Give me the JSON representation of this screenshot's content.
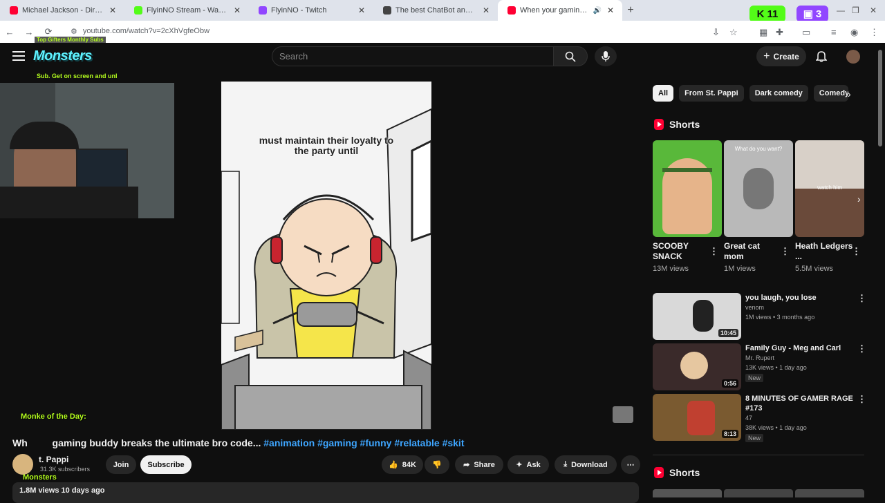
{
  "browser": {
    "tabs": [
      {
        "title": "Michael Jackson - Dirty Diana (",
        "favicon": "youtube-icon",
        "color": "#ff0033"
      },
      {
        "title": "FlyinNO Stream - Watch Live o",
        "favicon": "kick-icon",
        "color": "#53fc18"
      },
      {
        "title": "FlyinNO - Twitch",
        "favicon": "twitch-icon",
        "color": "#9146ff"
      },
      {
        "title": "The best ChatBot and Widgets",
        "favicon": "streamelements-icon",
        "color": "#444444"
      },
      {
        "title": "When your gaming buddy",
        "favicon": "youtube-icon",
        "color": "#ff0033",
        "active": true
      }
    ],
    "kick_count": "11",
    "twitch_count": "3",
    "url": "youtube.com/watch?v=2cXhVgfeObw"
  },
  "overlay": {
    "top_ticker": "Top Gifters Monthly Subs",
    "logo": "Monsters",
    "sub_ticker": "Sub. Get on screen and unl",
    "monke_label": "Monke of the Day:",
    "monsters_tag": "Monsters"
  },
  "yt": {
    "search_placeholder": "Search",
    "create_label": "Create"
  },
  "video": {
    "caption_line1": "must maintain their loyalty to",
    "caption_line2": "the party until",
    "title_prefix": "Wh",
    "title_main": "gaming buddy breaks the ultimate bro code...",
    "hashtags": [
      "#animation",
      "#gaming",
      "#funny",
      "#relatable",
      "#skit"
    ],
    "channel": "t. Pappi",
    "subscribers": "31.3K subscribers",
    "join": "Join",
    "subscribe": "Subscribe",
    "likes": "84K",
    "share": "Share",
    "ask": "Ask",
    "download": "Download",
    "views_date": "1.8M views  10 days ago"
  },
  "sidebar": {
    "chips": [
      "All",
      "From St. Pappi",
      "Dark comedy",
      "Comedy"
    ],
    "shorts_heading": "Shorts",
    "shorts": [
      {
        "title": "SCOOBY SNACK",
        "views": "13M views"
      },
      {
        "title": "Great cat mom",
        "views": "1M views",
        "thumb_text": "What do you want?"
      },
      {
        "title": "Heath Ledgers ...",
        "views": "5.5M views",
        "thumb_text": "watch him"
      }
    ],
    "related": [
      {
        "title": "you laugh, you lose",
        "channel": "venom",
        "meta": "1M views • 3 months ago",
        "duration": "10:45"
      },
      {
        "title": "Family Guy - Meg and Carl",
        "channel": "Mr. Rupert",
        "meta": "13K views • 1 day ago",
        "duration": "0:56",
        "badge": "New"
      },
      {
        "title": "8 MINUTES OF GAMER RAGE #173",
        "channel": "47",
        "meta": "38K views • 1 day ago",
        "duration": "8:13",
        "badge": "New"
      }
    ],
    "shorts_heading_2": "Shorts"
  }
}
